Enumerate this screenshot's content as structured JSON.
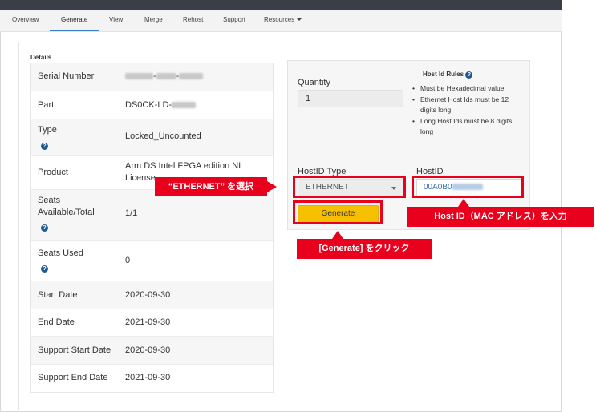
{
  "nav": {
    "items": [
      {
        "label": "Overview"
      },
      {
        "label": "Generate"
      },
      {
        "label": "View"
      },
      {
        "label": "Merge"
      },
      {
        "label": "Rehost"
      },
      {
        "label": "Support"
      },
      {
        "label": "Resources"
      }
    ],
    "active_index": 1
  },
  "details": {
    "section_label": "Details",
    "rows": [
      {
        "label": "Serial Number",
        "value": "-",
        "value_blurred": true
      },
      {
        "label": "Part",
        "value": "DS0CK-LD-",
        "value_blurred": true
      },
      {
        "label": "Type",
        "value": "Locked_Uncounted",
        "has_help": true
      },
      {
        "label": "Product",
        "value_line1": "Arm DS Intel FPGA edition NL",
        "value_line2": "License"
      },
      {
        "label_line1": "Seats",
        "label_line2": "Available/Total",
        "value": "1/1",
        "has_help": true
      },
      {
        "label": "Seats Used",
        "value": "0",
        "has_help": true
      },
      {
        "label": "Start Date",
        "value": "2020-09-30"
      },
      {
        "label": "End Date",
        "value": "2021-09-30"
      },
      {
        "label": "Support Start Date",
        "value": "2020-09-30"
      },
      {
        "label": "Support End Date",
        "value": "2021-09-30"
      }
    ]
  },
  "generate_form": {
    "quantity_label": "Quantity",
    "quantity_value": "1",
    "rules_title": "Host Id Rules",
    "rules": [
      "Must be Hexadecimal value",
      "Ethernet Host Ids must be 12 digits long",
      "Long Host Ids must be 8 digits long"
    ],
    "hostid_type_label": "HostID Type",
    "hostid_type_value": "ETHERNET",
    "hostid_label": "HostID",
    "hostid_value": "00A0B0",
    "generate_label": "Generate"
  },
  "annotations": {
    "select_ethernet": "“ETHERNET” を選択",
    "enter_hostid": "Host ID（MAC アドレス）を入力",
    "click_generate": "[Generate] をクリック"
  },
  "colors": {
    "accent_blue": "#3b7dc4",
    "button_yellow": "#f6c000",
    "annotation_red": "#e8001c",
    "topbar": "#3a3f47"
  }
}
